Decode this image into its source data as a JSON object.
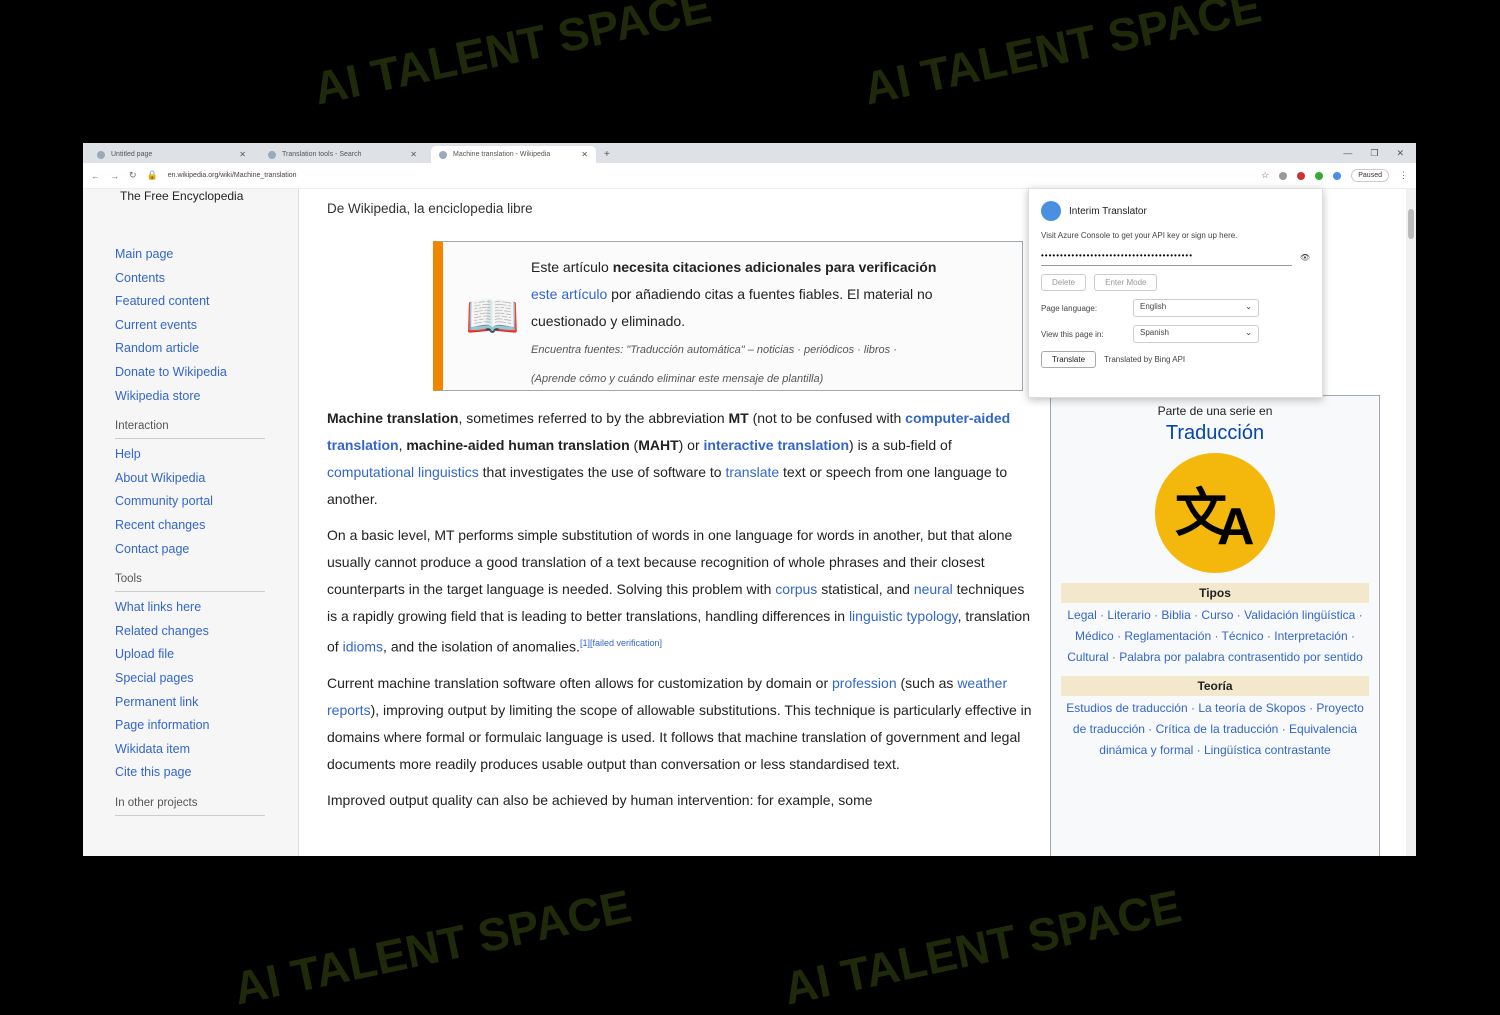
{
  "browser": {
    "tabs": [
      {
        "label": "Untitled page"
      },
      {
        "label": "Translation tools - Search"
      },
      {
        "label": "Machine translation - Wikipedia"
      }
    ],
    "new_tab": "+",
    "window_controls": [
      "—",
      "❐",
      "✕"
    ],
    "url": "en.wikipedia.org/wiki/Machine_translation",
    "profile": "Paused"
  },
  "sidebar": {
    "tagline": "The Free Encyclopedia",
    "nav": [
      "Main page",
      "Contents",
      "Featured content",
      "Current events",
      "Random article",
      "Donate to Wikipedia",
      "Wikipedia store"
    ],
    "interaction_head": "Interaction",
    "interaction": [
      "Help",
      "About Wikipedia",
      "Community portal",
      "Recent changes",
      "Contact page"
    ],
    "tools_head": "Tools",
    "tools": [
      "What links here",
      "Related changes",
      "Upload file",
      "Special pages",
      "Permanent link",
      "Page information",
      "Wikidata item",
      "Cite this page"
    ],
    "other_projects": "In other projects"
  },
  "content": {
    "from": "De Wikipedia, la enciclopedia libre",
    "ambox": {
      "line1_a": "Este artículo ",
      "line1_b": "necesita citaciones adicionales para verificación",
      "line2_a": "este artículo",
      "line2_b": " por añadiendo citas a fuentes fiables. El material no",
      "line3": "cuestionado y eliminado.",
      "sources": "Encuentra fuentes: \"Traducción automática\" – noticias · periódicos · libros ·",
      "learn": "(Aprende cómo y cuándo eliminar este mensaje de plantilla)"
    },
    "p1": {
      "a": "Machine translation",
      "b": ", sometimes referred to by the abbreviation ",
      "c": "MT",
      "d": " (not to be confused with ",
      "e": "computer-aided translation",
      "f": ", ",
      "g": "machine-aided human translation",
      "h": " (",
      "i": "MAHT",
      "j": ") or ",
      "k": "interactive translation",
      "l": ") is a sub-field of ",
      "m": "computational linguistics",
      "n": " that investigates the use of software to ",
      "o": "translate",
      "p": " text or speech from one language to another."
    },
    "p2": {
      "a": "On a basic level, MT performs simple substitution of words in one language for words in another, but that alone usually cannot produce a good translation of a text because recognition of whole phrases and their closest counterparts in the target language is needed. Solving this problem with ",
      "b": "corpus",
      "c": " statistical, and ",
      "d": "neural",
      "e": " techniques is a rapidly growing field that is leading to better translations, handling differences in ",
      "f": "linguistic typology",
      "g": ", translation of ",
      "h": "idioms",
      "i": ", and the isolation of anomalies.",
      "j": "[1][failed verification]"
    },
    "p3": {
      "a": "Current machine translation software often allows for customization by domain or ",
      "b": "profession",
      "c": " (such as ",
      "d": "weather reports",
      "e": "), improving output by limiting the scope of allowable substitutions. This technique is particularly effective in domains where formal or formulaic language is used. It follows that machine translation of government and legal documents more readily produces usable output than conversation or less standardised text."
    },
    "p4": "Improved output quality can also be achieved by human intervention: for example, some"
  },
  "infobox": {
    "partof": "Parte de una serie en",
    "title": "Traducción",
    "logo_glyph1": "文",
    "logo_glyph2": "A",
    "tipos_head": "Tipos",
    "tipos": "Legal · Literario · Biblia · Curso · Validación lingüística · Médico · Reglamentación · Técnico · Interpretación · Cultural · Palabra por palabra contrasentido por sentido",
    "teoria_head": "Teoría",
    "teoria": "Estudios de traducción · La teoría de Skopos · Proyecto de traducción · Crítica de la traducción · Equivalencia dinámica y formal · Lingüística contrastante"
  },
  "popup": {
    "title": "Interim Translator",
    "visit": "Visit Azure Console to get your API key or sign up here.",
    "api_key": "••••••••••••••••••••••••••••••••••••••••",
    "btn_delete": "Delete",
    "btn_change": "Enter Mode",
    "page_lang_label": "Page language:",
    "page_lang": "English",
    "view_label": "View this page in:",
    "view_lang": "Spanish",
    "translate": "Translate",
    "footer": "Translated by Bing API"
  },
  "watermark": "AI TALENT SPACE"
}
